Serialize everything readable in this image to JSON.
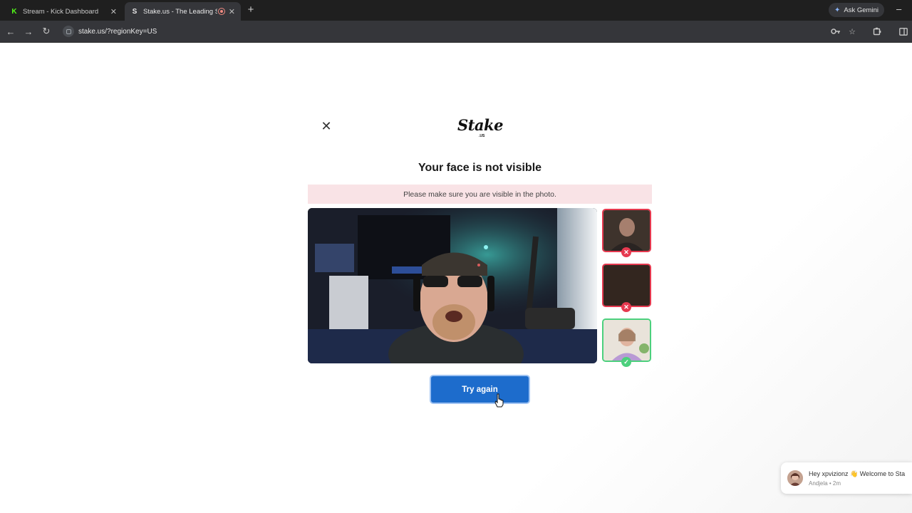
{
  "browser": {
    "tabs": [
      {
        "title": "Stream - Kick Dashboard",
        "favicon": "K",
        "active": false
      },
      {
        "title": "Stake.us - The Leading Soc",
        "favicon": "S",
        "active": true
      }
    ],
    "ask_gemini_label": "Ask Gemini",
    "url": "stake.us/?regionKey=US"
  },
  "modal": {
    "logo_text": "Stake",
    "logo_sub": ".US",
    "heading": "Your face is not visible",
    "alert_text": "Please make sure you are visible in the photo.",
    "examples": [
      {
        "status": "rejected"
      },
      {
        "status": "rejected"
      },
      {
        "status": "accepted"
      }
    ],
    "try_again_label": "Try again"
  },
  "chat_toast": {
    "message": "Hey xpvizionz 👋 Welcome to Sta",
    "meta": "Andjela • 2m"
  },
  "colors": {
    "accent": "#1d6ccc",
    "alert_bg": "#f9e3e6",
    "reject": "#e6394f",
    "accept": "#4cd07d"
  }
}
